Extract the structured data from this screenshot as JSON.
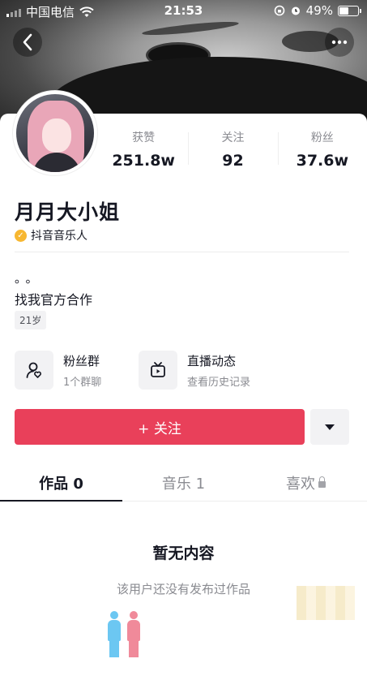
{
  "status_bar": {
    "carrier": "中国电信",
    "time": "21:53",
    "battery": "49%",
    "battery_level": 0.49
  },
  "header": {
    "back_icon": "chevron-left-icon",
    "more_icon": "more-icon"
  },
  "stats": [
    {
      "label": "获赞",
      "value": "251.8w"
    },
    {
      "label": "关注",
      "value": "92"
    },
    {
      "label": "粉丝",
      "value": "37.6w"
    }
  ],
  "profile": {
    "nickname": "月月大小姐",
    "verified_label": "抖音音乐人",
    "bio_line1": "。。",
    "bio_line2": "找我官方合作",
    "age": "21岁"
  },
  "entries": {
    "fans_group": {
      "title": "粉丝群",
      "subtitle": "1个群聊",
      "icon": "user-heart-icon"
    },
    "live": {
      "title": "直播动态",
      "subtitle": "查看历史记录",
      "icon": "tv-icon"
    }
  },
  "actions": {
    "follow_label": "+ 关注",
    "dropdown_icon": "caret-down-icon"
  },
  "tabs": [
    {
      "label": "作品 0",
      "active": true
    },
    {
      "label": "音乐 1",
      "active": false
    },
    {
      "label": "喜欢",
      "active": false,
      "locked": true
    }
  ],
  "empty": {
    "title": "暂无内容",
    "subtitle": "该用户还没有发布过作品"
  },
  "colors": {
    "accent": "#e9405a",
    "verify_badge": "#f7b731"
  }
}
